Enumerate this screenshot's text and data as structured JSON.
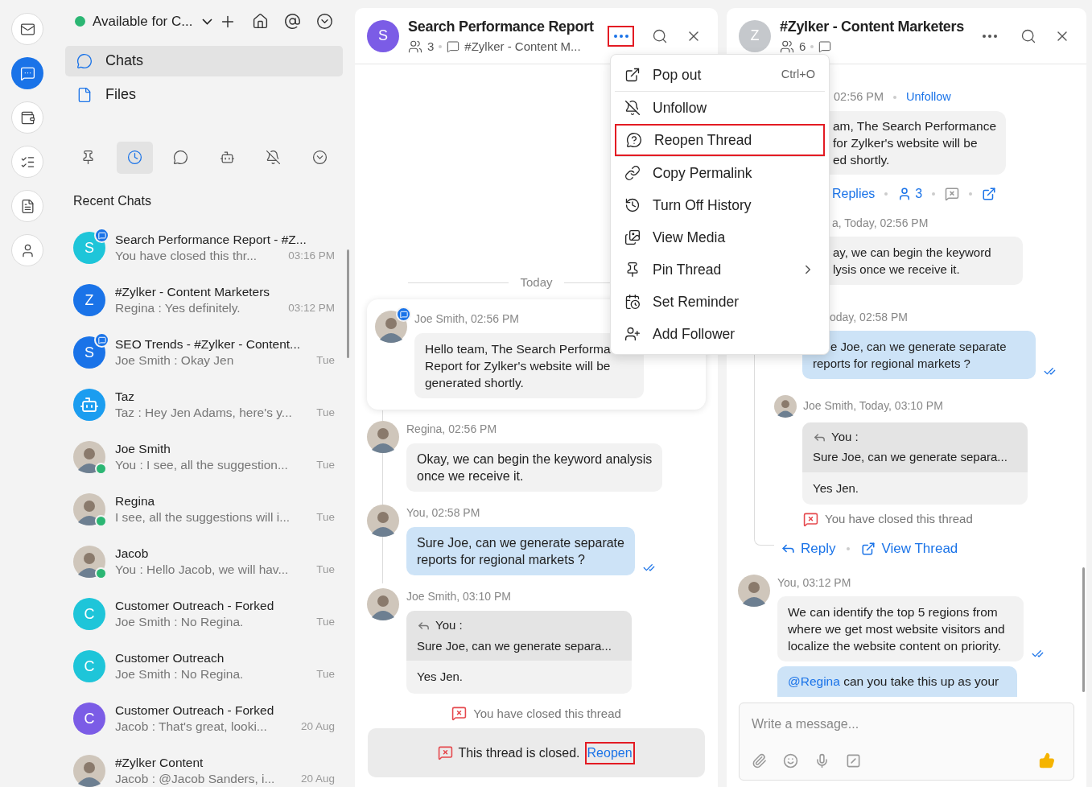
{
  "rail": [
    {
      "selected": false
    },
    {
      "selected": true
    },
    {
      "selected": false
    },
    {
      "selected": false
    },
    {
      "selected": false
    },
    {
      "selected": false
    }
  ],
  "sidebar": {
    "status": {
      "label": "Available for C...",
      "available": true
    },
    "nav": [
      {
        "label": "Chats",
        "selected": true
      },
      {
        "label": "Files",
        "selected": false
      }
    ],
    "filters": [
      {
        "selected": false
      },
      {
        "selected": true
      },
      {
        "selected": false
      },
      {
        "selected": false
      },
      {
        "selected": false
      },
      {
        "selected": false
      }
    ],
    "section_title": "Recent Chats",
    "chats": [
      {
        "name": "Search Performance Report - #Z...",
        "preview": "You have closed this thr...",
        "time": "03:16 PM",
        "avatar": {
          "kind": "letter",
          "letter": "S",
          "color": "#1ec5d9"
        },
        "thread": true,
        "online": false
      },
      {
        "name": "#Zylker - Content Marketers",
        "preview": "Regina : Yes definitely.",
        "time": "03:12 PM",
        "avatar": {
          "kind": "letter",
          "letter": "Z",
          "color": "#1a73e8"
        },
        "thread": false,
        "online": false
      },
      {
        "name": "SEO Trends - #Zylker - Content...",
        "preview": "Joe Smith : Okay Jen",
        "time": "Tue",
        "avatar": {
          "kind": "letter",
          "letter": "S",
          "color": "#1a73e8"
        },
        "thread": true,
        "online": false
      },
      {
        "name": "Taz",
        "preview": "Taz : Hey Jen Adams, here's y...",
        "time": "Tue",
        "avatar": {
          "kind": "bot"
        },
        "thread": false,
        "online": false
      },
      {
        "name": "Joe Smith",
        "preview": "You : I see, all the suggestion...",
        "time": "Tue",
        "avatar": {
          "kind": "photo"
        },
        "thread": false,
        "online": true
      },
      {
        "name": "Regina",
        "preview": "I see, all the suggestions will i...",
        "time": "Tue",
        "avatar": {
          "kind": "photo"
        },
        "thread": false,
        "online": true
      },
      {
        "name": "Jacob",
        "preview": "You : Hello Jacob, we will hav...",
        "time": "Tue",
        "avatar": {
          "kind": "photo"
        },
        "thread": false,
        "online": true
      },
      {
        "name": "Customer Outreach - Forked",
        "preview": "Joe Smith : No Regina.",
        "time": "Tue",
        "avatar": {
          "kind": "letter",
          "letter": "C",
          "color": "#1ec5d9"
        },
        "thread": false,
        "online": false
      },
      {
        "name": "Customer Outreach",
        "preview": "Joe Smith : No Regina.",
        "time": "Tue",
        "avatar": {
          "kind": "letter",
          "letter": "C",
          "color": "#1ec5d9"
        },
        "thread": false,
        "online": false
      },
      {
        "name": "Customer Outreach - Forked",
        "preview": "Jacob : That's great, looki...",
        "time": "20 Aug",
        "avatar": {
          "kind": "letter",
          "letter": "C",
          "color": "#7b5ce6"
        },
        "thread": false,
        "online": false
      },
      {
        "name": "#Zylker Content",
        "preview": "Jacob : @Jacob Sanders, i...",
        "time": "20 Aug",
        "avatar": {
          "kind": "photo"
        },
        "thread": false,
        "online": false
      }
    ]
  },
  "thread_panel": {
    "title": "Search Performance Report",
    "avatar": {
      "kind": "letter",
      "letter": "S",
      "color": "#7b5ce6"
    },
    "member_count": "3",
    "channel": "#Zylker - Content M...",
    "more_highlighted": true,
    "today": "Today",
    "parent": {
      "author": "Joe Smith, 02:56 PM",
      "text": "Hello team, The Search Performa\nReport for Zylker's website will be\ngenerated shortly."
    },
    "messages": [
      {
        "kind": "text",
        "author": "Regina, 02:56 PM",
        "text": "Okay, we can begin the keyword analysis\nonce we receive it.",
        "mine": false,
        "read": false
      },
      {
        "kind": "text",
        "author": "You, 02:58 PM",
        "text": "Sure Joe, can we generate separate\nreports for regional markets ?",
        "mine": true,
        "read": true
      },
      {
        "kind": "reply",
        "author": "Joe Smith, 03:10 PM",
        "quote_author": "You :",
        "quote": "Sure Joe, can we generate separa...",
        "text": "Yes Jen."
      }
    ],
    "closed_note": "You have closed this thread",
    "closed_bar": {
      "text": "This thread is closed.",
      "link": "Reopen",
      "highlighted": true
    }
  },
  "menu": [
    {
      "label": "Pop out",
      "shortcut": "Ctrl+O",
      "submenu": false,
      "highlighted": false,
      "divider_after": true
    },
    {
      "label": "Unfollow",
      "submenu": false,
      "highlighted": false,
      "divider_after": false
    },
    {
      "label": "Reopen Thread",
      "submenu": false,
      "highlighted": true,
      "divider_after": true
    },
    {
      "label": "Copy Permalink",
      "submenu": false,
      "highlighted": false,
      "divider_after": false
    },
    {
      "label": "Turn Off History",
      "submenu": false,
      "highlighted": false,
      "divider_after": false
    },
    {
      "label": "View Media",
      "submenu": false,
      "highlighted": false,
      "divider_after": false
    },
    {
      "label": "Pin Thread",
      "submenu": true,
      "highlighted": false,
      "divider_after": false
    },
    {
      "label": "Set Reminder",
      "submenu": false,
      "highlighted": false,
      "divider_after": false
    },
    {
      "label": "Add Follower",
      "submenu": false,
      "highlighted": false,
      "divider_after": false
    }
  ],
  "channel_panel": {
    "title": "#Zylker - Content Marketers",
    "avatar": {
      "kind": "letter",
      "letter": "Z",
      "color": "#c5c8cc"
    },
    "member_count": "6",
    "parent": {
      "time": "02:56 PM",
      "follow_link": "Unfollow",
      "text": "am, The Search Performance\nfor Zylker's website will be\ned shortly.",
      "replies_link": "Replies",
      "participants": "3"
    },
    "thread": [
      {
        "kind": "text",
        "author": "a, Today, 02:56 PM",
        "text": "ay, we can begin the keyword\nlysis once we receive it.",
        "mine": false,
        "read": false
      },
      {
        "kind": "text",
        "author": "oday, 02:58 PM",
        "text": "e Joe, can we generate separate\nreports for regional markets ?",
        "mine": true,
        "read": true
      },
      {
        "kind": "reply",
        "author": "Joe Smith, Today, 03:10 PM",
        "quote_author": "You :",
        "quote": "Sure Joe, can we generate separa...",
        "text": "Yes Jen."
      }
    ],
    "closed_note": "You have closed this thread",
    "reply_link": "Reply",
    "view_link": "View Thread",
    "messages": [
      {
        "author": "You, 03:12 PM",
        "text": "We can identify the top 5 regions from\nwhere we get most website visitors and\nlocalize the website content on priority.",
        "read": true
      },
      {
        "mention": "@Regina",
        "text": "can you take this up as your",
        "read": false
      }
    ],
    "composer": {
      "placeholder": "Write a message..."
    }
  }
}
